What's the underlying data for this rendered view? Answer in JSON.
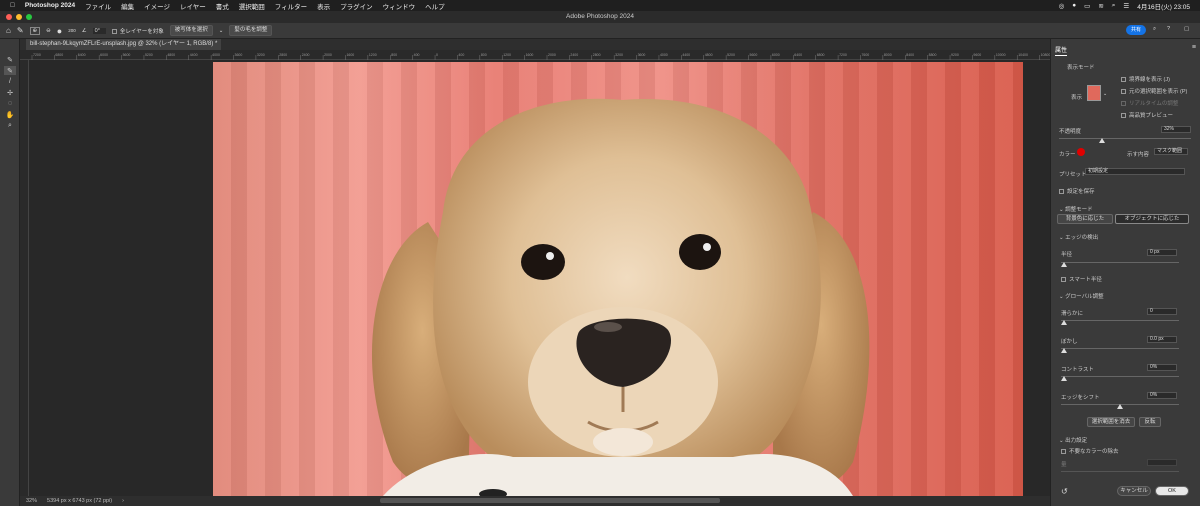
{
  "menubar": {
    "app": "Photoshop 2024",
    "items": [
      "ファイル",
      "編集",
      "イメージ",
      "レイヤー",
      "書式",
      "選択範囲",
      "フィルター",
      "表示",
      "プラグイン",
      "ウィンドウ",
      "ヘルプ"
    ],
    "datetime": "4月16日(火) 23:05"
  },
  "window": {
    "title": "Adobe Photoshop 2024"
  },
  "options": {
    "size_value": "200",
    "angle_value": "0°",
    "sample_all_label": "全レイヤーを対象",
    "select_subject_label": "被写体を選択",
    "refine_hair_label": "髪の毛を調整",
    "share_label": "共有"
  },
  "document": {
    "tab": "bill-stephan-9LkqymZFLrE-unsplash.jpg @ 32% (レイヤー 1, RGB/8) *"
  },
  "status": {
    "zoom": "32%",
    "info": "5394 px x 6743 px (72 ppi)"
  },
  "ruler": {
    "ticks": [
      "7200",
      "6800",
      "6400",
      "6000",
      "5600",
      "5200",
      "4800",
      "4400",
      "4000",
      "3600",
      "3200",
      "2800",
      "2400",
      "2000",
      "1600",
      "1200",
      "800",
      "400",
      "0",
      "400",
      "800",
      "1200",
      "1600",
      "2000",
      "2400",
      "2800",
      "3200",
      "3600",
      "4000",
      "4400",
      "4800",
      "5200",
      "5600",
      "6000",
      "6400",
      "6800",
      "7200",
      "7600",
      "8000",
      "8400",
      "8800",
      "9200",
      "9600",
      "10000",
      "10400",
      "10800"
    ]
  },
  "properties": {
    "tab": "属性",
    "view_mode": "表示モード",
    "view_label": "表示",
    "show_edge": "境界線を表示 (J)",
    "show_original": "元の選択範囲を表示 (P)",
    "realtime": "リアルタイムの調整",
    "hq_preview": "高品質プレビュー",
    "opacity_label": "不透明度",
    "opacity_value": "32%",
    "color_label": "カラー",
    "display_label": "示す内容",
    "display_value": "マスク範囲",
    "preset_label": "プリセット",
    "preset_value": "初期設定",
    "save_settings": "設定を保存",
    "adjust_mode": "調整モード",
    "mode_color": "背景色に応じた",
    "mode_object": "オブジェクトに応じた",
    "edge_detect": "エッジの検出",
    "radius_label": "半径",
    "radius_value": "0 px",
    "smart_radius": "スマート半径",
    "global": "グローバル調整",
    "smooth_label": "滑らかに",
    "smooth_value": "0",
    "feather_label": "ぼかし",
    "feather_value": "0.0 px",
    "contrast_label": "コントラスト",
    "contrast_value": "0%",
    "shift_label": "エッジをシフト",
    "shift_value": "0%",
    "clear_selection": "選択範囲を消去",
    "invert": "反転",
    "output": "出力設定",
    "decontaminate": "不要なカラーの除去",
    "amount_label": "量",
    "cancel": "キャンセル",
    "ok": "OK"
  },
  "colors": {
    "accent": "#1473e6",
    "overlay": "#e0695c",
    "swatch_red": "#e00000"
  }
}
